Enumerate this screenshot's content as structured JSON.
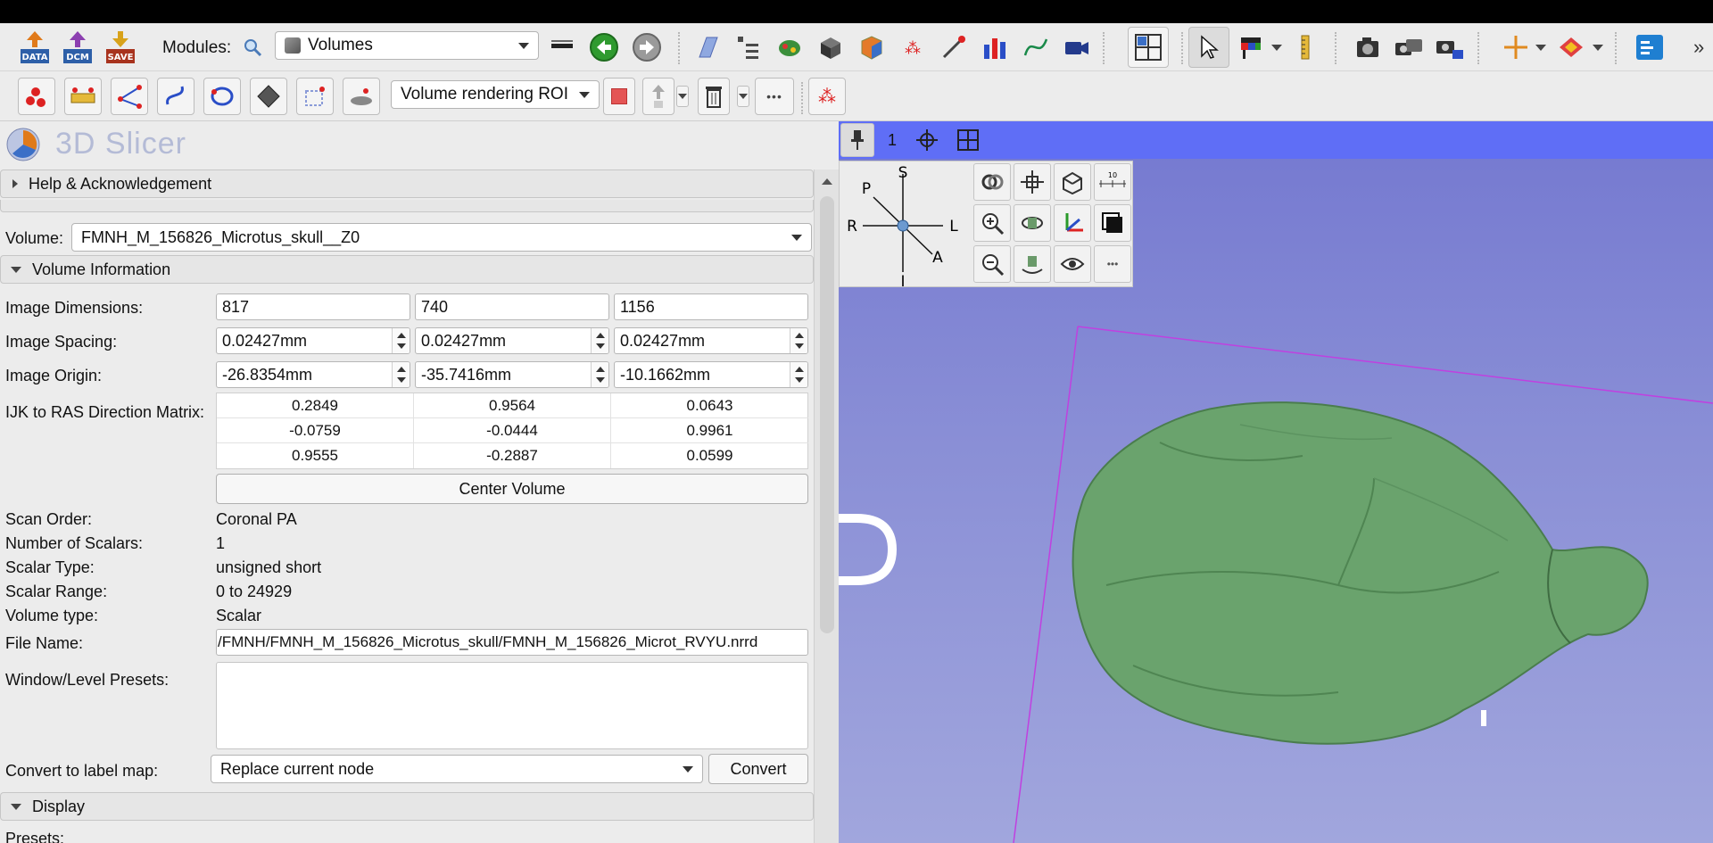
{
  "toolbar": {
    "modules_label": "Modules:",
    "module_selected": "Volumes",
    "buttons": [
      {
        "name": "data",
        "text": "DATA"
      },
      {
        "name": "dcm",
        "text": "DCM"
      },
      {
        "name": "save",
        "text": "SAVE"
      }
    ],
    "roi_selected": "Volume rendering ROI",
    "more_label": "»"
  },
  "app": {
    "title": "3D Slicer"
  },
  "sections": {
    "help": "Help & Acknowledgement",
    "volume_info": "Volume Information",
    "display": "Display"
  },
  "volume": {
    "label": "Volume:",
    "selected": "FMNH_M_156826_Microtus_skull__Z0"
  },
  "info": {
    "dimensions_label": "Image Dimensions:",
    "dimensions": [
      "817",
      "740",
      "1156"
    ],
    "spacing_label": "Image Spacing:",
    "spacing": [
      "0.02427mm",
      "0.02427mm",
      "0.02427mm"
    ],
    "origin_label": "Image Origin:",
    "origin": [
      "-26.8354mm",
      "-35.7416mm",
      "-10.1662mm"
    ],
    "matrix_label": "IJK to RAS Direction Matrix:",
    "matrix": [
      [
        "0.2849",
        "0.9564",
        "0.0643"
      ],
      [
        "-0.0759",
        "-0.0444",
        "0.9961"
      ],
      [
        "0.9555",
        "-0.2887",
        "0.0599"
      ]
    ],
    "center_volume": "Center Volume",
    "scan_order_label": "Scan Order:",
    "scan_order": "Coronal PA",
    "num_scalars_label": "Number of Scalars:",
    "num_scalars": "1",
    "scalar_type_label": "Scalar Type:",
    "scalar_type": "unsigned short",
    "scalar_range_label": "Scalar Range:",
    "scalar_range": "0 to 24929",
    "volume_type_label": "Volume type:",
    "volume_type": "Scalar",
    "file_name_label": "File Name:",
    "file_name": "/FMNH/FMNH_M_156826_Microtus_skull/FMNH_M_156826_Microt_RVYU.nrrd",
    "wl_presets_label": "Window/Level Presets:",
    "convert_label": "Convert to label map:",
    "convert_option": "Replace current node",
    "convert_button": "Convert",
    "presets_label": "Presets:"
  },
  "view": {
    "number": "1",
    "orientation": {
      "S": "S",
      "P": "P",
      "R": "R",
      "L": "L",
      "A": "A",
      "I": "I"
    },
    "ruler_label": "10"
  },
  "colors": {
    "model_green": "#6aa36d",
    "view_bg": "#7c81d3",
    "view_bar": "#5f6ef6"
  }
}
